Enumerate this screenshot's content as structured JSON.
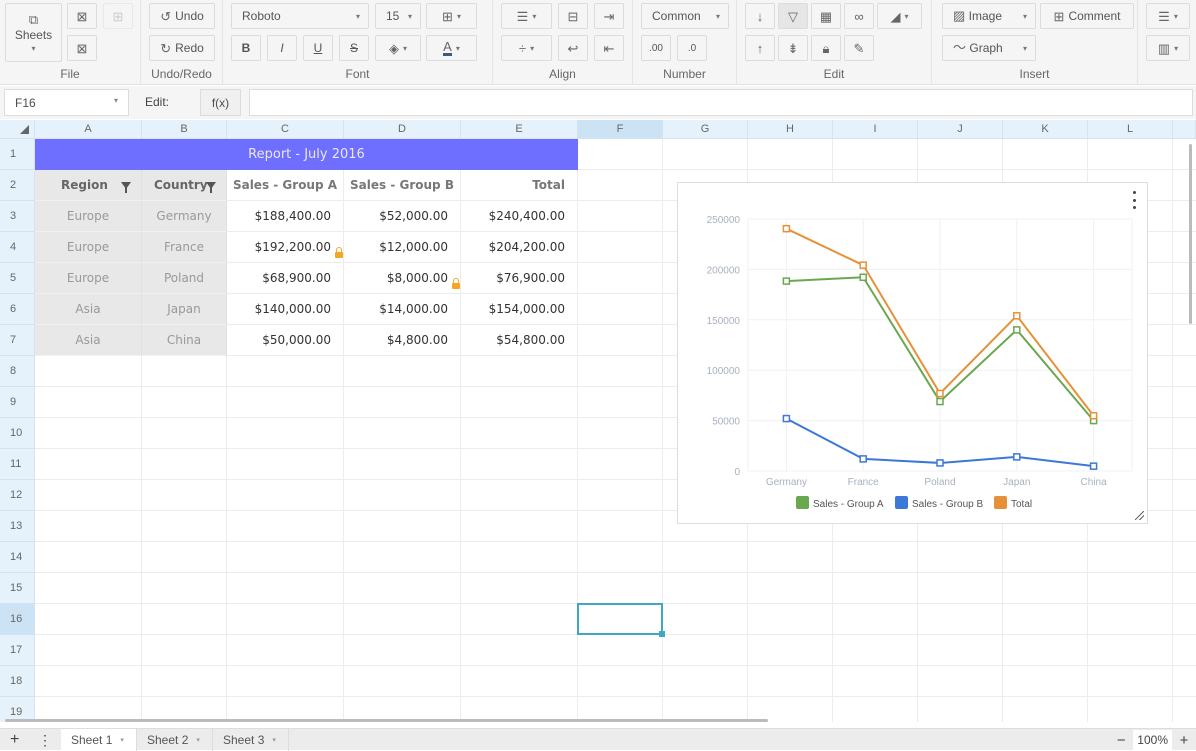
{
  "toolbar": {
    "file": {
      "label": "File",
      "sheets_label": "Sheets"
    },
    "undo_redo": {
      "label": "Undo/Redo",
      "undo": "Undo",
      "redo": "Redo"
    },
    "font": {
      "label": "Font",
      "family": "Roboto",
      "size": "15",
      "bold": "B",
      "italic": "I",
      "underline": "U",
      "strike": "S"
    },
    "align": {
      "label": "Align"
    },
    "number": {
      "label": "Number",
      "format": "Common"
    },
    "edit": {
      "label": "Edit"
    },
    "insert": {
      "label": "Insert",
      "image": "Image",
      "comment": "Comment",
      "graph": "Graph"
    }
  },
  "formula_bar": {
    "cell_ref": "F16",
    "edit_label": "Edit:",
    "fx_label": "f(x)",
    "value": ""
  },
  "columns": [
    "A",
    "B",
    "C",
    "D",
    "E",
    "F",
    "G",
    "H",
    "I",
    "J",
    "K",
    "L"
  ],
  "selected_column": "F",
  "rows": [
    "1",
    "2",
    "3",
    "4",
    "5",
    "6",
    "7",
    "8",
    "9",
    "10",
    "11",
    "12",
    "13",
    "14",
    "15",
    "16",
    "17",
    "18",
    "19"
  ],
  "selected_row": "16",
  "sheet": {
    "title": "Report - July 2016",
    "headers": [
      "Region",
      "Country",
      "Sales - Group A",
      "Sales - Group B",
      "Total"
    ],
    "data": [
      [
        "Europe",
        "Germany",
        "$188,400.00",
        "$52,000.00",
        "$240,400.00"
      ],
      [
        "Europe",
        "France",
        "$192,200.00",
        "$12,000.00",
        "$204,200.00"
      ],
      [
        "Europe",
        "Poland",
        "$68,900.00",
        "$8,000.00",
        "$76,900.00"
      ],
      [
        "Asia",
        "Japan",
        "$140,000.00",
        "$14,000.00",
        "$154,000.00"
      ],
      [
        "Asia",
        "China",
        "$50,000.00",
        "$4,800.00",
        "$54,800.00"
      ]
    ],
    "title_color": "#6e6eff",
    "locked_cells": [
      "C4",
      "D5"
    ]
  },
  "chart_data": {
    "type": "line",
    "categories": [
      "Germany",
      "France",
      "Poland",
      "Japan",
      "China"
    ],
    "series": [
      {
        "name": "Sales - Group A",
        "color": "#6aa84f",
        "values": [
          188400,
          192200,
          68900,
          140000,
          50000
        ]
      },
      {
        "name": "Sales - Group B",
        "color": "#3c78d8",
        "values": [
          52000,
          12000,
          8000,
          14000,
          4800
        ]
      },
      {
        "name": "Total",
        "color": "#e69138",
        "values": [
          240400,
          204200,
          76900,
          154000,
          54800
        ]
      }
    ],
    "yticks": [
      0,
      50000,
      100000,
      150000,
      200000,
      250000
    ],
    "ylim": [
      0,
      250000
    ],
    "title": "",
    "xlabel": "",
    "ylabel": "",
    "grid": true,
    "legend": "bottom"
  },
  "sheet_tabs": [
    {
      "label": "Sheet 1",
      "active": true
    },
    {
      "label": "Sheet 2",
      "active": false
    },
    {
      "label": "Sheet 3",
      "active": false
    }
  ],
  "zoom": {
    "value": "100%",
    "minus": "−",
    "plus": "+"
  },
  "sheetbar": {
    "add": "+",
    "menu": "⋮"
  }
}
